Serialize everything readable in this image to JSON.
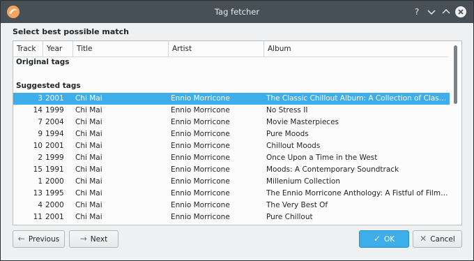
{
  "window": {
    "title": "Tag fetcher"
  },
  "titlebar_buttons": {
    "help": "?",
    "minimize": "⌄",
    "maximize": "⌃",
    "close": "✕"
  },
  "heading": "Select best possible match",
  "columns": [
    "Track",
    "Year",
    "Title",
    "Artist",
    "Album"
  ],
  "groups": {
    "original": "Original tags",
    "suggested": "Suggested tags"
  },
  "rows": [
    {
      "track": "3",
      "year": "2001",
      "title": "Chi Mai",
      "artist": "Ennio Morricone",
      "album": "The Classic Chillout Album: A Collection of Class...",
      "selected": true
    },
    {
      "track": "14",
      "year": "1999",
      "title": "Chi Mai",
      "artist": "Ennio Morricone",
      "album": "No Stress II"
    },
    {
      "track": "7",
      "year": "2004",
      "title": "Chi Mai",
      "artist": "Ennio Morricone",
      "album": "Movie Masterpieces"
    },
    {
      "track": "9",
      "year": "1994",
      "title": "Chi Mai",
      "artist": "Ennio Morricone",
      "album": "Pure Moods"
    },
    {
      "track": "10",
      "year": "2001",
      "title": "Chi Mai",
      "artist": "Ennio Morricone",
      "album": "Chillout Moods"
    },
    {
      "track": "2",
      "year": "1999",
      "title": "Chi Mai",
      "artist": "Ennio Morricone",
      "album": "Once Upon a Time in the West"
    },
    {
      "track": "15",
      "year": "1991",
      "title": "Chi Mai",
      "artist": "Ennio Morricone",
      "album": "Moods: A Contemporary Soundtrack"
    },
    {
      "track": "1",
      "year": "2000",
      "title": "Chi Mai",
      "artist": "Ennio Morricone",
      "album": "Millenium Collection"
    },
    {
      "track": "13",
      "year": "1995",
      "title": "Chi Mai",
      "artist": "Ennio Morricone",
      "album": "The Ennio Morricone Anthology: A Fistful of Film ..."
    },
    {
      "track": "4",
      "year": "2000",
      "title": "Chi Mai",
      "artist": "Ennio Morricone",
      "album": "The Very Best Of"
    },
    {
      "track": "11",
      "year": "2001",
      "title": "Chi Mai",
      "artist": "Ennio Morricone",
      "album": "Pure Chillout"
    }
  ],
  "buttons": {
    "previous": "Previous",
    "next": "Next",
    "ok": "OK",
    "cancel": "Cancel"
  },
  "colors": {
    "accent": "#3daee9",
    "titlebar": "#475057",
    "window_bg": "#eff0f1"
  },
  "icons": {
    "app": "app-logo-icon",
    "previous": "arrow-left-icon",
    "next": "arrow-right-icon",
    "ok": "checkmark-icon",
    "cancel": "x-mark-icon"
  }
}
